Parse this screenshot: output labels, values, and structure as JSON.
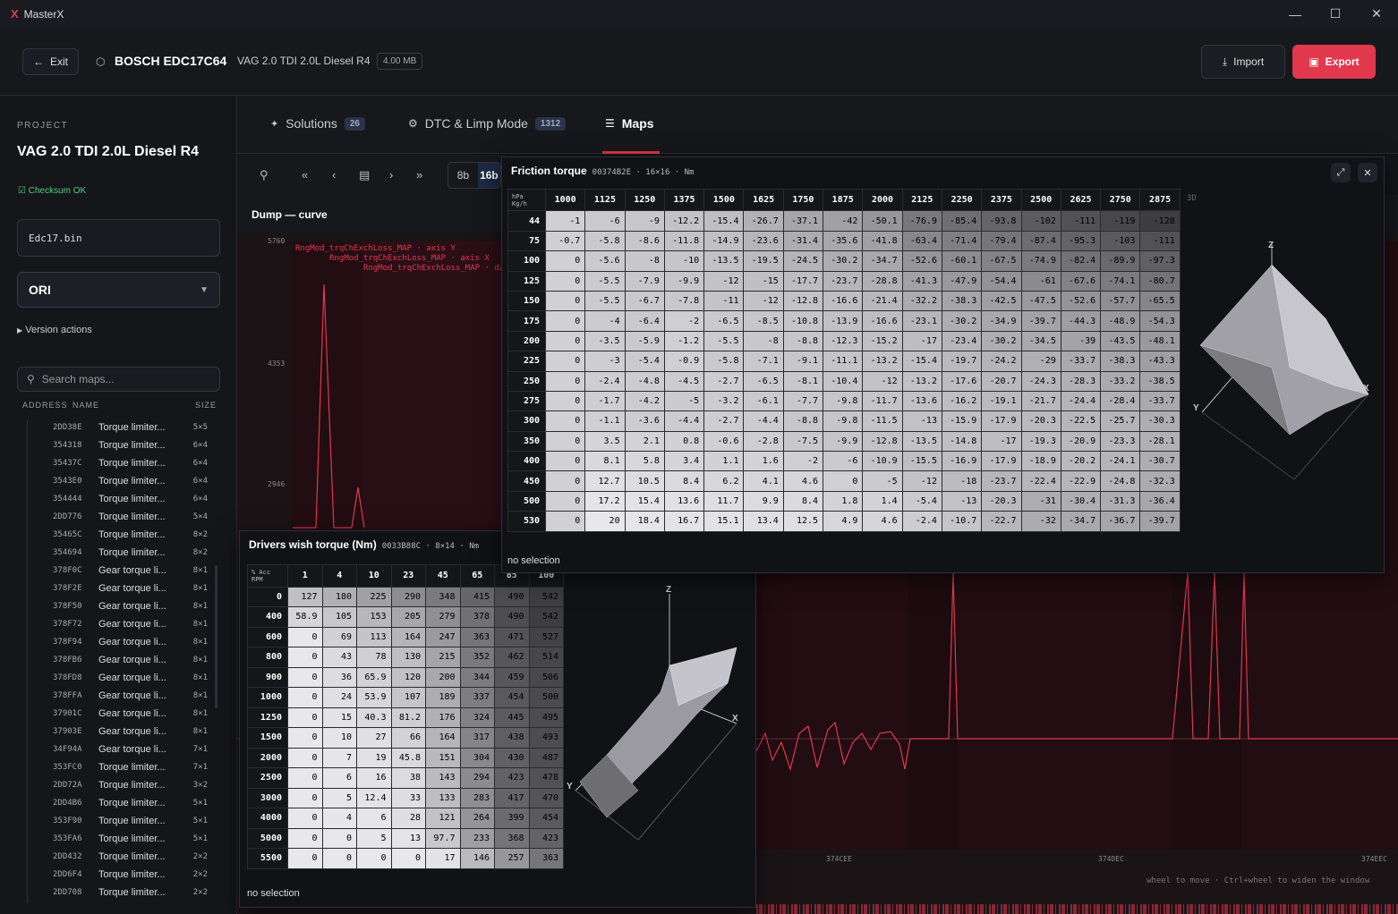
{
  "app": {
    "title": "MasterX",
    "logo": "X"
  },
  "header": {
    "exit_label": "Exit",
    "ecu": "BOSCH EDC17C64",
    "vehicle": "VAG 2.0 TDI 2.0L Diesel R4",
    "file_size": "4.00 MB",
    "import_label": "Import",
    "export_label": "Export"
  },
  "sidebar": {
    "project_label": "PROJECT",
    "project_name": "VAG 2.0 TDI 2.0L Diesel R4",
    "checksum": "Checksum OK",
    "file": "Edc17.bin",
    "version": "ORI",
    "version_actions": "Version actions",
    "search_placeholder": "Search maps...",
    "col_address": "ADDRESS",
    "col_name": "NAME",
    "col_size": "SIZE",
    "maps": [
      {
        "a": "2DD38E",
        "n": "Torque limiter...",
        "s": "5×5"
      },
      {
        "a": "354318",
        "n": "Torque limiter...",
        "s": "6×4"
      },
      {
        "a": "35437C",
        "n": "Torque limiter...",
        "s": "6×4"
      },
      {
        "a": "3543E0",
        "n": "Torque limiter...",
        "s": "6×4"
      },
      {
        "a": "354444",
        "n": "Torque limiter...",
        "s": "6×4"
      },
      {
        "a": "2DD776",
        "n": "Torque limiter...",
        "s": "5×4"
      },
      {
        "a": "35465C",
        "n": "Torque limiter...",
        "s": "8×2"
      },
      {
        "a": "354694",
        "n": "Torque limiter...",
        "s": "8×2"
      },
      {
        "a": "378F0C",
        "n": "Gear torque li...",
        "s": "8×1"
      },
      {
        "a": "378F2E",
        "n": "Gear torque li...",
        "s": "8×1"
      },
      {
        "a": "378F50",
        "n": "Gear torque li...",
        "s": "8×1"
      },
      {
        "a": "378F72",
        "n": "Gear torque li...",
        "s": "8×1"
      },
      {
        "a": "378F94",
        "n": "Gear torque li...",
        "s": "8×1"
      },
      {
        "a": "378FB6",
        "n": "Gear torque li...",
        "s": "8×1"
      },
      {
        "a": "378FD8",
        "n": "Gear torque li...",
        "s": "8×1"
      },
      {
        "a": "378FFA",
        "n": "Gear torque li...",
        "s": "8×1"
      },
      {
        "a": "37901C",
        "n": "Gear torque li...",
        "s": "8×1"
      },
      {
        "a": "37903E",
        "n": "Gear torque li...",
        "s": "8×1"
      },
      {
        "a": "34F94A",
        "n": "Gear torque li...",
        "s": "7×1"
      },
      {
        "a": "353FC0",
        "n": "Torque limiter...",
        "s": "7×1"
      },
      {
        "a": "2DD72A",
        "n": "Torque limiter...",
        "s": "3×2"
      },
      {
        "a": "2DD4B6",
        "n": "Torque limiter...",
        "s": "5×1"
      },
      {
        "a": "353F90",
        "n": "Torque limiter...",
        "s": "5×1"
      },
      {
        "a": "353FA6",
        "n": "Torque limiter...",
        "s": "5×1"
      },
      {
        "a": "2DD432",
        "n": "Torque limiter...",
        "s": "2×2"
      },
      {
        "a": "2DD6F4",
        "n": "Torque limiter...",
        "s": "2×2"
      },
      {
        "a": "2DD708",
        "n": "Torque limiter...",
        "s": "2×2"
      }
    ]
  },
  "tabs": [
    {
      "label": "Solutions",
      "count": "26"
    },
    {
      "label": "DTC & Limp Mode",
      "count": "1312"
    },
    {
      "label": "Maps",
      "count": ""
    }
  ],
  "toolbar": {
    "bits": [
      "8b",
      "16b"
    ]
  },
  "curve": {
    "title": "Dump — curve",
    "y_ticks": [
      "5760",
      "4353",
      "2946"
    ],
    "x_ticks": [
      "374CEE",
      "374DEC",
      "374EEC"
    ],
    "legend": [
      "RngMod_trqChExchLoss_MAP · axis Y",
      "RngMod_trqChExchLoss_MAP · axis X",
      "RngMod_trqChExchLoss_MAP · da"
    ],
    "hint": "wheel to move · Ctrl+wheel to widen the window"
  },
  "friction": {
    "title": "Friction torque",
    "meta": "00374B2E · 16×16 · Nm",
    "row_unit": "Kg/h",
    "col_unit": "hPa",
    "view": "3D",
    "status": "no selection",
    "cols": [
      "1000",
      "1125",
      "1250",
      "1375",
      "1500",
      "1625",
      "1750",
      "1875",
      "2000",
      "2125",
      "2250",
      "2375",
      "2500",
      "2625",
      "2750",
      "2875"
    ],
    "rows": [
      "44",
      "75",
      "100",
      "125",
      "150",
      "175",
      "200",
      "225",
      "250",
      "275",
      "300",
      "350",
      "400",
      "450",
      "500",
      "530"
    ],
    "cells": [
      [
        "-1",
        "-6",
        "-9",
        "-12.2",
        "-15.4",
        "-26.7",
        "-37.1",
        "-42",
        "-50.1",
        "-76.9",
        "-85.4",
        "-93.8",
        "-102",
        "-111",
        "-119",
        "-128"
      ],
      [
        "-0.7",
        "-5.8",
        "-8.6",
        "-11.8",
        "-14.9",
        "-23.6",
        "-31.4",
        "-35.6",
        "-41.8",
        "-63.4",
        "-71.4",
        "-79.4",
        "-87.4",
        "-95.3",
        "-103",
        "-111"
      ],
      [
        "0",
        "-5.6",
        "-8",
        "-10",
        "-13.5",
        "-19.5",
        "-24.5",
        "-30.2",
        "-34.7",
        "-52.6",
        "-60.1",
        "-67.5",
        "-74.9",
        "-82.4",
        "-89.9",
        "-97.3"
      ],
      [
        "0",
        "-5.5",
        "-7.9",
        "-9.9",
        "-12",
        "-15",
        "-17.7",
        "-23.7",
        "-28.8",
        "-41.3",
        "-47.9",
        "-54.4",
        "-61",
        "-67.6",
        "-74.1",
        "-80.7"
      ],
      [
        "0",
        "-5.5",
        "-6.7",
        "-7.8",
        "-11",
        "-12",
        "-12.8",
        "-16.6",
        "-21.4",
        "-32.2",
        "-38.3",
        "-42.5",
        "-47.5",
        "-52.6",
        "-57.7",
        "-65.5"
      ],
      [
        "0",
        "-4",
        "-6.4",
        "-2",
        "-6.5",
        "-8.5",
        "-10.8",
        "-13.9",
        "-16.6",
        "-23.1",
        "-30.2",
        "-34.9",
        "-39.7",
        "-44.3",
        "-48.9",
        "-54.3"
      ],
      [
        "0",
        "-3.5",
        "-5.9",
        "-1.2",
        "-5.5",
        "-8",
        "-8.8",
        "-12.3",
        "-15.2",
        "-17",
        "-23.4",
        "-30.2",
        "-34.5",
        "-39",
        "-43.5",
        "-48.1"
      ],
      [
        "0",
        "-3",
        "-5.4",
        "-0.9",
        "-5.8",
        "-7.1",
        "-9.1",
        "-11.1",
        "-13.2",
        "-15.4",
        "-19.7",
        "-24.2",
        "-29",
        "-33.7",
        "-38.3",
        "-43.3"
      ],
      [
        "0",
        "-2.4",
        "-4.8",
        "-4.5",
        "-2.7",
        "-6.5",
        "-8.1",
        "-10.4",
        "-12",
        "-13.2",
        "-17.6",
        "-20.7",
        "-24.3",
        "-28.3",
        "-33.2",
        "-38.5"
      ],
      [
        "0",
        "-1.7",
        "-4.2",
        "-5",
        "-3.2",
        "-6.1",
        "-7.7",
        "-9.8",
        "-11.7",
        "-13.6",
        "-16.2",
        "-19.1",
        "-21.7",
        "-24.4",
        "-28.4",
        "-33.7"
      ],
      [
        "0",
        "-1.1",
        "-3.6",
        "-4.4",
        "-2.7",
        "-4.4",
        "-8.8",
        "-9.8",
        "-11.5",
        "-13",
        "-15.9",
        "-17.9",
        "-20.3",
        "-22.5",
        "-25.7",
        "-30.3"
      ],
      [
        "0",
        "3.5",
        "2.1",
        "0.8",
        "-0.6",
        "-2.8",
        "-7.5",
        "-9.9",
        "-12.8",
        "-13.5",
        "-14.8",
        "-17",
        "-19.3",
        "-20.9",
        "-23.3",
        "-28.1"
      ],
      [
        "0",
        "8.1",
        "5.8",
        "3.4",
        "1.1",
        "1.6",
        "-2",
        "-6",
        "-10.9",
        "-15.5",
        "-16.9",
        "-17.9",
        "-18.9",
        "-20.2",
        "-24.1",
        "-30.7"
      ],
      [
        "0",
        "12.7",
        "10.5",
        "8.4",
        "6.2",
        "4.1",
        "4.6",
        "0",
        "-5",
        "-12",
        "-18",
        "-23.7",
        "-22.4",
        "-22.9",
        "-24.8",
        "-32.3"
      ],
      [
        "0",
        "17.2",
        "15.4",
        "13.6",
        "11.7",
        "9.9",
        "8.4",
        "1.8",
        "1.4",
        "-5.4",
        "-13",
        "-20.3",
        "-31",
        "-30.4",
        "-31.3",
        "-36.4"
      ],
      [
        "0",
        "20",
        "18.4",
        "16.7",
        "15.1",
        "13.4",
        "12.5",
        "4.9",
        "4.6",
        "-2.4",
        "-10.7",
        "-22.7",
        "-32",
        "-34.7",
        "-36.7",
        "-39.7"
      ]
    ]
  },
  "drivers": {
    "title": "Drivers wish torque (Nm)",
    "meta": "0033B88C · 8×14 · Nm",
    "row_unit": "RPM",
    "col_unit": "% Acc",
    "status": "no selection",
    "cols": [
      "1",
      "4",
      "10",
      "23",
      "45",
      "65",
      "85",
      "100"
    ],
    "rows": [
      "0",
      "400",
      "600",
      "800",
      "900",
      "1000",
      "1250",
      "1500",
      "2000",
      "2500",
      "3000",
      "4000",
      "5000",
      "5500"
    ],
    "cells": [
      [
        "127",
        "180",
        "225",
        "290",
        "348",
        "415",
        "490",
        "542"
      ],
      [
        "58.9",
        "105",
        "153",
        "205",
        "279",
        "378",
        "490",
        "542"
      ],
      [
        "0",
        "69",
        "113",
        "164",
        "247",
        "363",
        "471",
        "527"
      ],
      [
        "0",
        "43",
        "78",
        "130",
        "215",
        "352",
        "462",
        "514"
      ],
      [
        "0",
        "36",
        "65.9",
        "120",
        "200",
        "344",
        "459",
        "506"
      ],
      [
        "0",
        "24",
        "53.9",
        "107",
        "189",
        "337",
        "454",
        "500"
      ],
      [
        "0",
        "15",
        "40.3",
        "81.2",
        "176",
        "324",
        "445",
        "495"
      ],
      [
        "0",
        "10",
        "27",
        "66",
        "164",
        "317",
        "438",
        "493"
      ],
      [
        "0",
        "7",
        "19",
        "45.8",
        "151",
        "304",
        "430",
        "487"
      ],
      [
        "0",
        "6",
        "16",
        "38",
        "143",
        "294",
        "423",
        "478"
      ],
      [
        "0",
        "5",
        "12.4",
        "33",
        "133",
        "283",
        "417",
        "470"
      ],
      [
        "0",
        "4",
        "6",
        "28",
        "121",
        "264",
        "399",
        "454"
      ],
      [
        "0",
        "0",
        "5",
        "13",
        "97.7",
        "233",
        "368",
        "423"
      ],
      [
        "0",
        "0",
        "0",
        "0",
        "17",
        "146",
        "257",
        "363"
      ]
    ]
  },
  "axes3d": {
    "x": "X",
    "y": "Y",
    "z": "Z"
  },
  "colors": {
    "accent": "#e2384e",
    "ok": "#4ed07f"
  }
}
